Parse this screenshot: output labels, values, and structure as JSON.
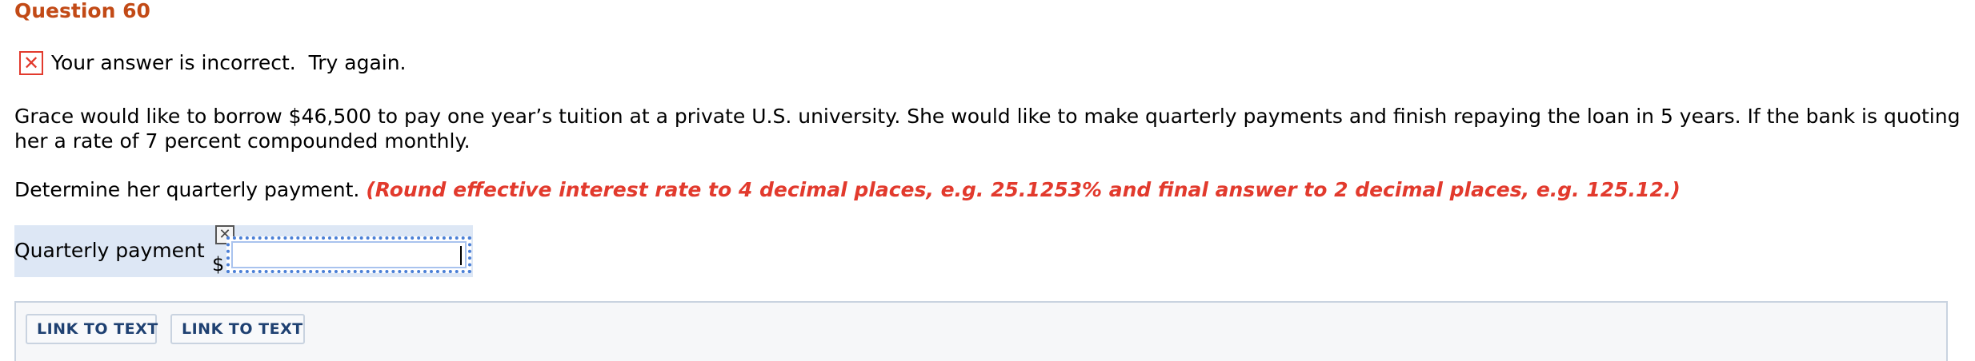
{
  "question": {
    "title": "Question 60"
  },
  "feedback": {
    "icon": "x-icon",
    "text": "Your answer is incorrect.  Try again.",
    "color": "#e23a2d"
  },
  "problem": {
    "text": "Grace would like to borrow $46,500 to pay one year’s tuition at a private U.S. university. She would like to make quarterly payments and finish repaying the loan in 5 years. If the bank is quoting her a rate of 7 percent compounded monthly."
  },
  "instruction": {
    "text": "Determine her quarterly payment.",
    "hint": "(Round effective interest rate to 4 decimal places, e.g. 25.1253% and final answer to 2 decimal places, e.g. 125.12.)"
  },
  "answer": {
    "label": "Quarterly payment",
    "currency": "$",
    "value": "",
    "close_icon": "close-icon"
  },
  "links": [
    {
      "label": "LINK TO TEXT"
    },
    {
      "label": "LINK TO TEXT"
    }
  ],
  "colors": {
    "title": "#c24a16",
    "hint": "#e23a2d",
    "answer_row_bg": "#dde7f5",
    "link_text": "#1f4172"
  }
}
